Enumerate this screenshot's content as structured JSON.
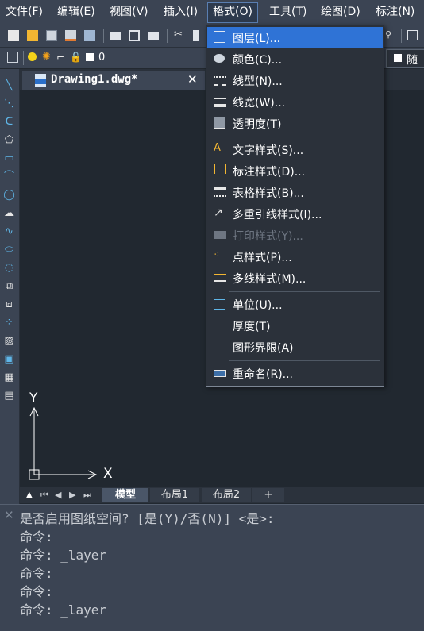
{
  "menubar": {
    "items": [
      "文件(F)",
      "编辑(E)",
      "视图(V)",
      "插入(I)",
      "格式(O)",
      "工具(T)",
      "绘图(D)",
      "标注(N)"
    ]
  },
  "toolbar2": {
    "layer_value": "0",
    "color_value": "随层"
  },
  "document": {
    "tab_title": "Drawing1.dwg*",
    "close_glyph": "✕"
  },
  "canvas": {
    "ucs_y": "Y",
    "ucs_x": "X"
  },
  "layout_tabs": {
    "items": [
      "模型",
      "布局1",
      "布局2",
      "+"
    ]
  },
  "format_menu": {
    "items": [
      {
        "label": "图层(L)...",
        "icon": "layer-icon"
      },
      {
        "label": "颜色(C)...",
        "icon": "palette-icon"
      },
      {
        "label": "线型(N)...",
        "icon": "linetype-icon"
      },
      {
        "label": "线宽(W)...",
        "icon": "lineweight-icon"
      },
      {
        "label": "透明度(T)",
        "icon": "transparency-icon"
      },
      {
        "label": "文字样式(S)...",
        "icon": "text-style-icon"
      },
      {
        "label": "标注样式(D)...",
        "icon": "dim-style-icon"
      },
      {
        "label": "表格样式(B)...",
        "icon": "table-style-icon"
      },
      {
        "label": "多重引线样式(I)...",
        "icon": "mleader-style-icon"
      },
      {
        "label": "打印样式(Y)...",
        "icon": "plot-style-icon"
      },
      {
        "label": "点样式(P)...",
        "icon": "point-style-icon"
      },
      {
        "label": "多线样式(M)...",
        "icon": "mline-style-icon"
      },
      {
        "label": "单位(U)...",
        "icon": "units-icon"
      },
      {
        "label": "厚度(T)",
        "icon": ""
      },
      {
        "label": "图形界限(A)",
        "icon": "limits-icon"
      },
      {
        "label": "重命名(R)...",
        "icon": "rename-icon"
      }
    ]
  },
  "command": {
    "lines": [
      "是否启用图纸空间? [是(Y)/否(N)] <是>:",
      "命令:",
      "命令: _layer",
      "命令:",
      "命令:",
      "命令: _layer"
    ]
  }
}
